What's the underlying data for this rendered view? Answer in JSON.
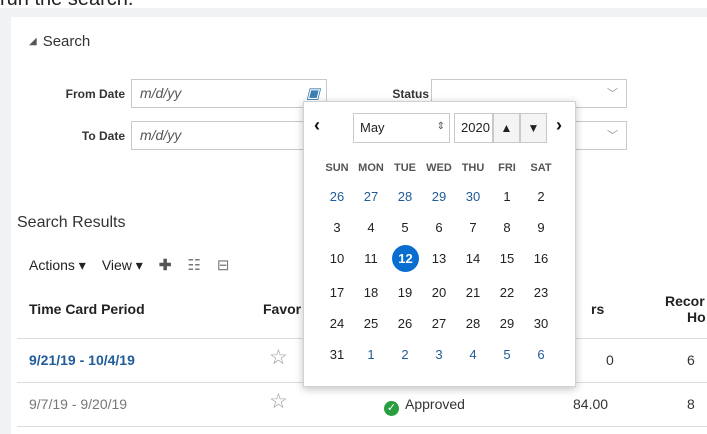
{
  "top_text": "run the search.",
  "search": {
    "header": "Search",
    "from_date_label": "From Date",
    "from_date_placeholder": "m/d/yy",
    "to_date_label": "To Date",
    "to_date_placeholder": "m/d/yy",
    "status_label": "Status",
    "status_value": ""
  },
  "results": {
    "title": "Search Results",
    "actions_label": "Actions ▾",
    "view_label": "View ▾",
    "columns": [
      "Time Card Period",
      "Favor",
      "rs",
      "Recor",
      "Ho"
    ],
    "rows": [
      {
        "period": "9/21/19 - 10/4/19",
        "status": "",
        "hours": "0",
        "recorded": "6"
      },
      {
        "period": "9/7/19 - 9/20/19",
        "status": "Approved",
        "hours": "84.00",
        "recorded": "8"
      }
    ]
  },
  "calendar": {
    "month": "May",
    "year": "2020",
    "prev": "‹",
    "next": "›",
    "weekdays": [
      "SUN",
      "MON",
      "TUE",
      "WED",
      "THU",
      "FRI",
      "SAT"
    ],
    "weeks": [
      [
        "26",
        "27",
        "28",
        "29",
        "30",
        "1",
        "2"
      ],
      [
        "3",
        "4",
        "5",
        "6",
        "7",
        "8",
        "9"
      ],
      [
        "10",
        "11",
        "12",
        "13",
        "14",
        "15",
        "16"
      ],
      [
        "17",
        "18",
        "19",
        "20",
        "21",
        "22",
        "23"
      ],
      [
        "24",
        "25",
        "26",
        "27",
        "28",
        "29",
        "30"
      ],
      [
        "31",
        "1",
        "2",
        "3",
        "4",
        "5",
        "6"
      ]
    ],
    "other_month_cells": [
      [
        0,
        0
      ],
      [
        0,
        1
      ],
      [
        0,
        2
      ],
      [
        0,
        3
      ],
      [
        0,
        4
      ],
      [
        5,
        1
      ],
      [
        5,
        2
      ],
      [
        5,
        3
      ],
      [
        5,
        4
      ],
      [
        5,
        5
      ],
      [
        5,
        6
      ]
    ],
    "selected_cell": [
      2,
      2
    ]
  },
  "colors": {
    "accent": "#0a6ed1",
    "link": "#1f5c99",
    "approved": "#2a9d3e"
  }
}
